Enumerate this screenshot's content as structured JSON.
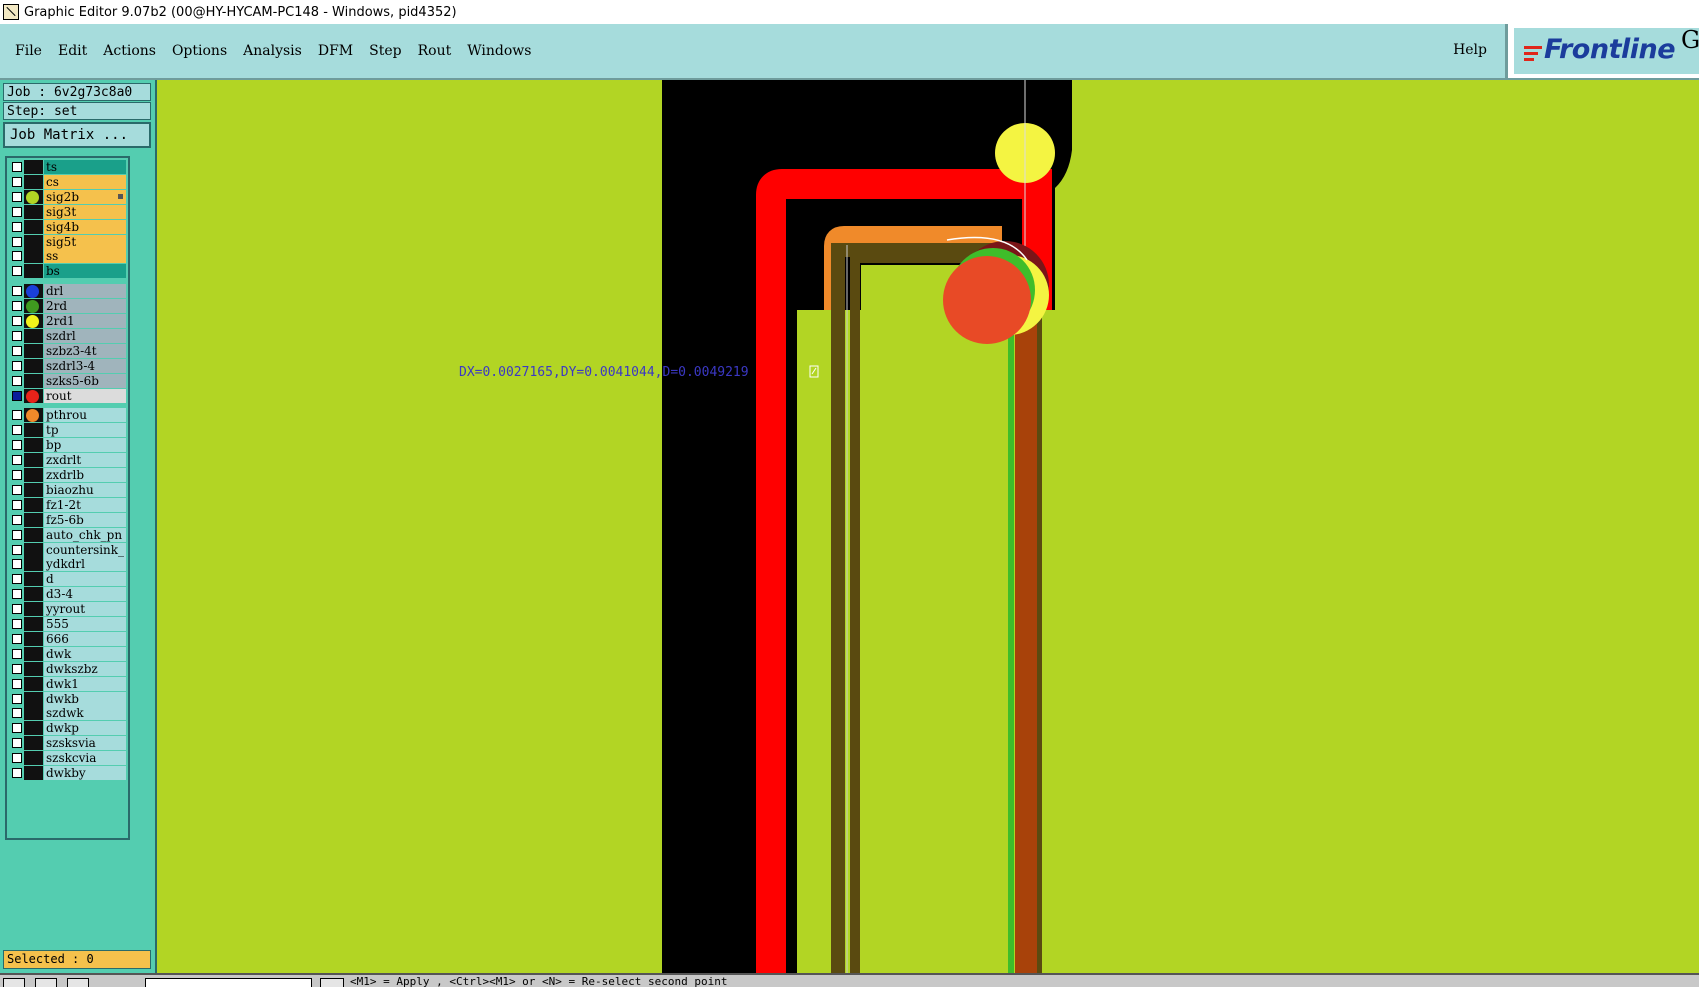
{
  "window": {
    "title": "Graphic Editor 9.07b2 (00@HY-HYCAM-PC148 - Windows, pid4352)"
  },
  "menu": {
    "items": [
      "File",
      "Edit",
      "Actions",
      "Options",
      "Analysis",
      "DFM",
      "Step",
      "Rout",
      "Windows"
    ],
    "help": "Help"
  },
  "logo": {
    "text": "Frontline",
    "suffix": "Ge"
  },
  "job": {
    "job_label": "Job : 6v2g73c8a0",
    "step_label": "Step: set",
    "matrix_button": "Job Matrix ..."
  },
  "layers": [
    {
      "name": "ts",
      "bg": "#1aa08a",
      "dot": ""
    },
    {
      "name": "cs",
      "bg": "#f5c14c",
      "dot": ""
    },
    {
      "name": "sig2b",
      "bg": "#f5c14c",
      "dot": "#b2d524",
      "mark": true
    },
    {
      "name": "sig3t",
      "bg": "#f5c14c",
      "dot": ""
    },
    {
      "name": "sig4b",
      "bg": "#f5c14c",
      "dot": ""
    },
    {
      "name": "sig5t",
      "bg": "#f5c14c",
      "dot": ""
    },
    {
      "name": "ss",
      "bg": "#f5c14c",
      "dot": ""
    },
    {
      "name": "bs",
      "bg": "#1aa08a",
      "dot": ""
    },
    {
      "name": "drl",
      "bg": "#a0b4bc",
      "dot": "#1a3fd8"
    },
    {
      "name": "2rd",
      "bg": "#a0b4bc",
      "dot": "#3f9a1f"
    },
    {
      "name": "2rd1",
      "bg": "#a0b4bc",
      "dot": "#f2f21a"
    },
    {
      "name": "szdrl",
      "bg": "#a0b4bc",
      "dot": ""
    },
    {
      "name": "szbz3-4t",
      "bg": "#a0b4bc",
      "dot": ""
    },
    {
      "name": "szdrl3-4",
      "bg": "#a0b4bc",
      "dot": ""
    },
    {
      "name": "szks5-6b",
      "bg": "#a0b4bc",
      "dot": ""
    },
    {
      "name": "rout",
      "bg": "#dcdcdc",
      "dot": "#e8231a",
      "checked": true
    },
    {
      "name": "pthrou",
      "bg": "#a6dcdc",
      "dot": "#f08a2a"
    },
    {
      "name": "tp",
      "bg": "#a6dcdc",
      "dot": ""
    },
    {
      "name": "bp",
      "bg": "#a6dcdc",
      "dot": ""
    },
    {
      "name": "zxdrlt",
      "bg": "#a6dcdc",
      "dot": ""
    },
    {
      "name": "zxdrlb",
      "bg": "#a6dcdc",
      "dot": ""
    },
    {
      "name": "biaozhu",
      "bg": "#a6dcdc",
      "dot": ""
    },
    {
      "name": "fz1-2t",
      "bg": "#a6dcdc",
      "dot": ""
    },
    {
      "name": "fz5-6b",
      "bg": "#a6dcdc",
      "dot": ""
    },
    {
      "name": "auto_chk_pn",
      "bg": "#a6dcdc",
      "dot": ""
    },
    {
      "name": "countersink_",
      "bg": "#a6dcdc",
      "dot": ""
    },
    {
      "name": "ydkdrl",
      "bg": "#a6dcdc",
      "dot": ""
    },
    {
      "name": "d",
      "bg": "#a6dcdc",
      "dot": ""
    },
    {
      "name": "d3-4",
      "bg": "#a6dcdc",
      "dot": ""
    },
    {
      "name": "yyrout",
      "bg": "#a6dcdc",
      "dot": ""
    },
    {
      "name": "555",
      "bg": "#a6dcdc",
      "dot": ""
    },
    {
      "name": "666",
      "bg": "#a6dcdc",
      "dot": ""
    },
    {
      "name": "dwk",
      "bg": "#a6dcdc",
      "dot": ""
    },
    {
      "name": "dwkszbz",
      "bg": "#a6dcdc",
      "dot": ""
    },
    {
      "name": "dwk1",
      "bg": "#a6dcdc",
      "dot": ""
    },
    {
      "name": "dwkb",
      "bg": "#a6dcdc",
      "dot": ""
    },
    {
      "name": "szdwk",
      "bg": "#a6dcdc",
      "dot": ""
    },
    {
      "name": "dwkp",
      "bg": "#a6dcdc",
      "dot": ""
    },
    {
      "name": "szsksvia",
      "bg": "#a6dcdc",
      "dot": ""
    },
    {
      "name": "szskcvia",
      "bg": "#a6dcdc",
      "dot": ""
    },
    {
      "name": "dwkby",
      "bg": "#a6dcdc",
      "dot": ""
    }
  ],
  "selected": "Selected : 0",
  "measurement": "DX=0.0027165,DY=0.0041044,D=0.0049219",
  "status": {
    "prompt": "<M1> = Apply , <Ctrl><M1> or <N> = Re-select second point"
  },
  "colors": {
    "canvas_bg": "#b2d524",
    "copper": "#000000",
    "rout_path": "#ff0000",
    "pad_yellow": "#f4f442",
    "pthrou": "#f08a2a",
    "brown": "#a8420a",
    "olive": "#5a4a10"
  }
}
